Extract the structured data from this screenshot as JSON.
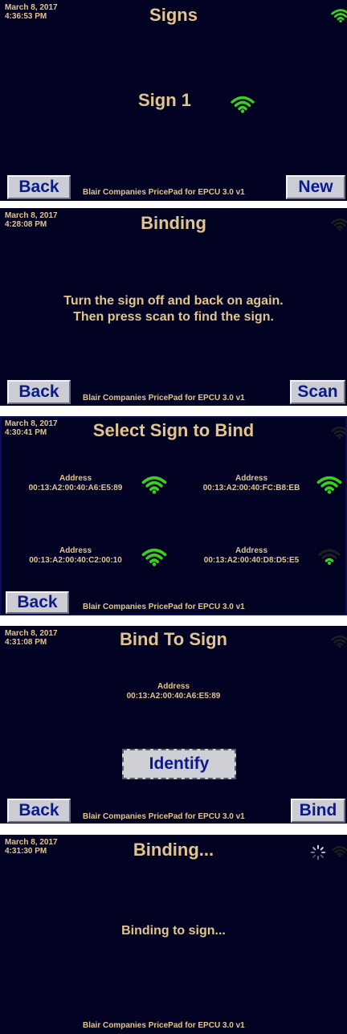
{
  "footer_text": "Blair Companies PricePad for EPCU 3.0 v1",
  "colors": {
    "background": "#020323",
    "text": "#e2c58c",
    "button": "#ccccd4",
    "button_text": "#0a1a8c",
    "wifi_on": "#38d11c",
    "wifi_off": "#1e1e1e"
  },
  "screens": {
    "signs": {
      "date": "March 8, 2017",
      "time": "4:36:53 PM",
      "title": "Signs",
      "status_icon": "wifi-icon",
      "sign_label": "Sign 1",
      "sign_icon": "wifi-icon",
      "back_label": "Back",
      "new_label": "New"
    },
    "binding": {
      "date": "March 8, 2017",
      "time": "4:28:08 PM",
      "title": "Binding",
      "line1": "Turn the sign off and back on again.",
      "line2": "Then press scan to find the sign.",
      "back_label": "Back",
      "scan_label": "Scan"
    },
    "select": {
      "date": "March 8, 2017",
      "time": "4:30:41 PM",
      "title": "Select Sign to Bind",
      "address_label": "Address",
      "devices": [
        {
          "address": "00:13:A2:00:40:A6:E5:89",
          "signal": "strong"
        },
        {
          "address": "00:13:A2:00:40:FC:B8:EB",
          "signal": "strong"
        },
        {
          "address": "00:13:A2:00:40:C2:00:10",
          "signal": "strong"
        },
        {
          "address": "00:13:A2:00:40:D8:D5:E5",
          "signal": "weak"
        }
      ],
      "back_label": "Back"
    },
    "bind_to_sign": {
      "date": "March 8, 2017",
      "time": "4:31:08 PM",
      "title": "Bind To Sign",
      "address_label": "Address",
      "address": "00:13:A2:00:40:A6:E5:89",
      "identify_label": "Identify",
      "back_label": "Back",
      "bind_label": "Bind"
    },
    "binding_progress": {
      "date": "March 8, 2017",
      "time": "4:31:30 PM",
      "title": "Binding...",
      "message": "Binding to sign..."
    }
  }
}
